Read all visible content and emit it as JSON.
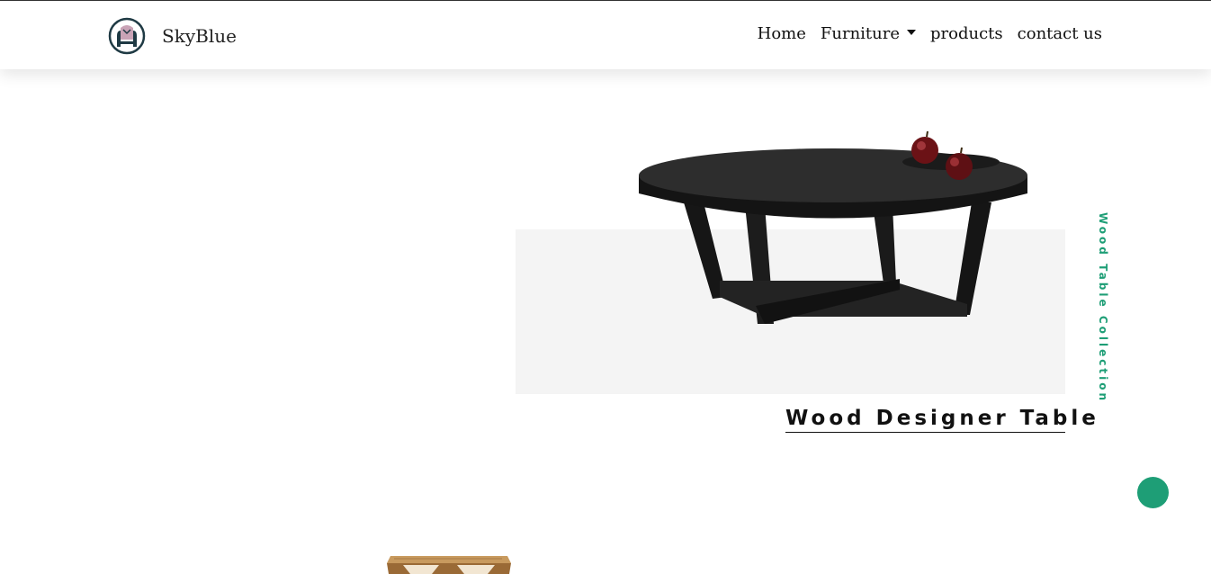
{
  "brand": {
    "name": "SkyBlue",
    "logo_icon": "armchair-logo-icon"
  },
  "nav": {
    "home": "Home",
    "furniture": "Furniture",
    "products": "products",
    "contact": "contact us"
  },
  "hero": {
    "vertical_label": "Wood Table Collection",
    "product_title": "Wood Designer Table",
    "image_icon": "round-coffee-table-image"
  },
  "colors": {
    "accent": "#1e9e76",
    "panel": "#f4f4f4",
    "text": "#111111"
  },
  "scroll_button": {
    "icon": "scroll-top-circle"
  }
}
